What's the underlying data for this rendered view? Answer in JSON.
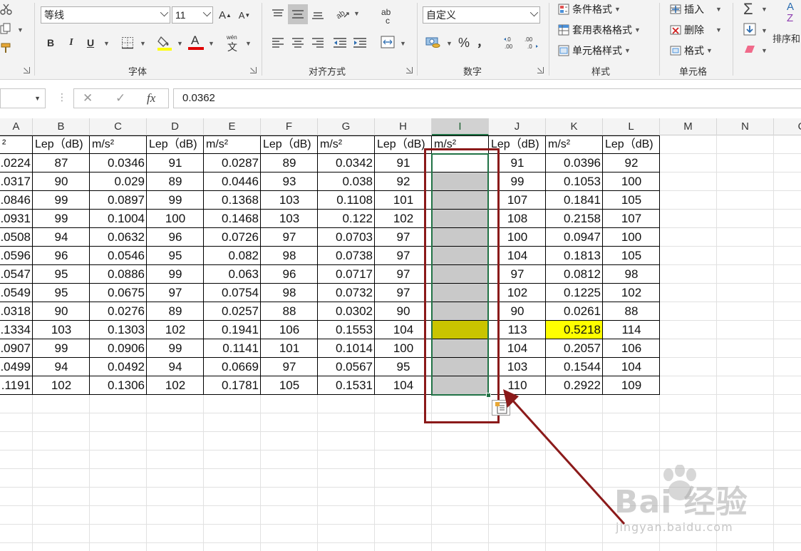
{
  "ribbon": {
    "font_group": {
      "label": "字体",
      "font_name": "等线",
      "font_size": "11",
      "grow_label": "A",
      "shrink_label": "A",
      "bold_label": "B",
      "italic_label": "I",
      "underline_label": "U",
      "highlight_label": "",
      "font_color_label": "A",
      "phonetic_label": "wén",
      "phonetic_sub": "文",
      "highlight_color": "#ffff00",
      "font_color": "#e00000"
    },
    "align_group": {
      "label": "对齐方式",
      "wrap_label": "ab",
      "wrap_sub": "c"
    },
    "number_group": {
      "label": "数字",
      "format": "自定义",
      "percent_label": "%",
      "comma_label": "，",
      "inc_dec_label": "←.0 .00",
      "dec_dec_label": ".00 →.0"
    },
    "styles_group": {
      "label": "样式",
      "conditional": "条件格式",
      "table_format": "套用表格格式",
      "cell_styles": "单元格样式"
    },
    "cells_group": {
      "label": "单元格",
      "insert": "插入",
      "delete": "删除",
      "format": "格式"
    },
    "editing_group": {
      "sum_label": "Σ",
      "sort_label": "排序和",
      "az_label": "A Z"
    }
  },
  "formula_bar": {
    "name_box": "",
    "dots": "⋮",
    "cancel": "✕",
    "enter": "✓",
    "fx": "fx",
    "value": "0.0362"
  },
  "columns": [
    "A",
    "B",
    "C",
    "D",
    "E",
    "F",
    "G",
    "H",
    "I",
    "J",
    "K",
    "L",
    "M",
    "N",
    "O"
  ],
  "header_row": {
    "A": "²",
    "B": "Lep（dB)",
    "C": "m/s²",
    "D": "Lep（dB)",
    "E": "m/s²",
    "F": "Lep（dB)",
    "G": "m/s²",
    "H": "Lep（dB)",
    "I": "m/s²",
    "J": "Lep（dB)",
    "K": "m/s²",
    "L": "Lep（dB)"
  },
  "rows": [
    {
      "A": ".0224",
      "B": "87",
      "C": "0.0346",
      "D": "91",
      "E": "0.0287",
      "F": "89",
      "G": "0.0342",
      "H": "91",
      "J": "91",
      "K": "0.0396",
      "L": "92"
    },
    {
      "A": ".0317",
      "B": "90",
      "C": "0.029",
      "D": "89",
      "E": "0.0446",
      "F": "93",
      "G": "0.038",
      "H": "92",
      "J": "99",
      "K": "0.1053",
      "L": "100"
    },
    {
      "A": ".0846",
      "B": "99",
      "C": "0.0897",
      "D": "99",
      "E": "0.1368",
      "F": "103",
      "G": "0.1108",
      "H": "101",
      "J": "107",
      "K": "0.1841",
      "L": "105"
    },
    {
      "A": ".0931",
      "B": "99",
      "C": "0.1004",
      "D": "100",
      "E": "0.1468",
      "F": "103",
      "G": "0.122",
      "H": "102",
      "J": "108",
      "K": "0.2158",
      "L": "107"
    },
    {
      "A": ".0508",
      "B": "94",
      "C": "0.0632",
      "D": "96",
      "E": "0.0726",
      "F": "97",
      "G": "0.0703",
      "H": "97",
      "J": "100",
      "K": "0.0947",
      "L": "100"
    },
    {
      "A": ".0596",
      "B": "96",
      "C": "0.0546",
      "D": "95",
      "E": "0.082",
      "F": "98",
      "G": "0.0738",
      "H": "97",
      "J": "104",
      "K": "0.1813",
      "L": "105"
    },
    {
      "A": ".0547",
      "B": "95",
      "C": "0.0886",
      "D": "99",
      "E": "0.063",
      "F": "96",
      "G": "0.0717",
      "H": "97",
      "J": "97",
      "K": "0.0812",
      "L": "98"
    },
    {
      "A": ".0549",
      "B": "95",
      "C": "0.0675",
      "D": "97",
      "E": "0.0754",
      "F": "98",
      "G": "0.0732",
      "H": "97",
      "J": "102",
      "K": "0.1225",
      "L": "102"
    },
    {
      "A": ".0318",
      "B": "90",
      "C": "0.0276",
      "D": "89",
      "E": "0.0257",
      "F": "88",
      "G": "0.0302",
      "H": "90",
      "J": "90",
      "K": "0.0261",
      "L": "88"
    },
    {
      "A": ".1334",
      "B": "103",
      "C": "0.1303",
      "D": "102",
      "E": "0.1941",
      "F": "106",
      "G": "0.1553",
      "H": "104",
      "J": "113",
      "K": "0.5218",
      "L": "114"
    },
    {
      "A": ".0907",
      "B": "99",
      "C": "0.0906",
      "D": "99",
      "E": "0.1141",
      "F": "101",
      "G": "0.1014",
      "H": "100",
      "J": "104",
      "K": "0.2057",
      "L": "106"
    },
    {
      "A": ".0499",
      "B": "94",
      "C": "0.0492",
      "D": "94",
      "E": "0.0669",
      "F": "97",
      "G": "0.0567",
      "H": "95",
      "J": "103",
      "K": "0.1544",
      "L": "104"
    },
    {
      "A": ".1191",
      "B": "102",
      "C": "0.1306",
      "D": "102",
      "E": "0.1781",
      "F": "105",
      "G": "0.1531",
      "H": "104",
      "J": "110",
      "K": "0.2922",
      "L": "109"
    }
  ],
  "highlights": {
    "K_row10_color": "#ffff00",
    "I_row10_color": "#c9c400",
    "selection_fill": "#c9c9c9",
    "selection_border": "#217346",
    "annotation_color": "#8b1a1a"
  },
  "watermark": {
    "main": "Bai 经验",
    "url": "jingyan.baidu.com"
  }
}
